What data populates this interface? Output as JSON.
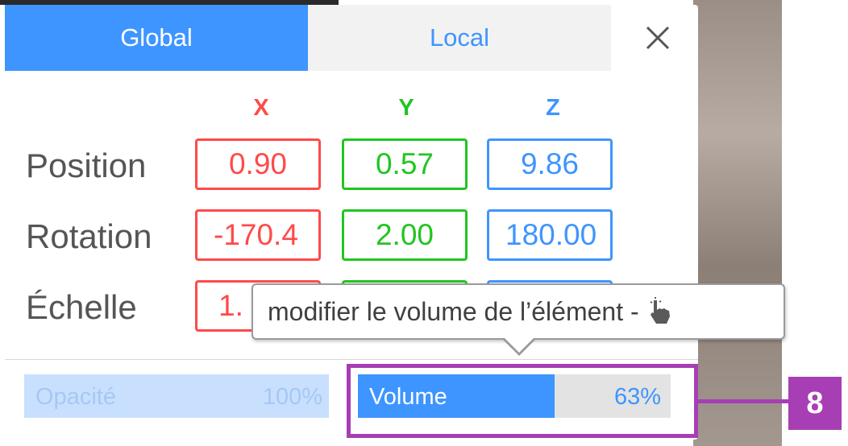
{
  "tabs": {
    "global": "Global",
    "local": "Local",
    "active": "global"
  },
  "axes": {
    "x": "X",
    "y": "Y",
    "z": "Z"
  },
  "rows": {
    "position": {
      "label": "Position",
      "x": "0.90",
      "y": "0.57",
      "z": "9.86"
    },
    "rotation": {
      "label": "Rotation",
      "x": "-170.4",
      "y": "2.00",
      "z": "180.00"
    },
    "scale": {
      "label": "Échelle",
      "x": "1.",
      "y": "",
      "z": ""
    }
  },
  "sliders": {
    "opacity": {
      "label": "Opacité",
      "value_text": "100%",
      "value": 1.0
    },
    "volume": {
      "label": "Volume",
      "value_text": "63%",
      "value": 0.63
    }
  },
  "tooltip": {
    "text": "modifier le volume de l’élément -",
    "icon": "pointing-hand-icon"
  },
  "step_badge": "8",
  "colors": {
    "accent": "#3e95ff",
    "x_axis": "#ff4a4a",
    "y_axis": "#21c521",
    "z_axis": "#3e95ff",
    "highlight": "#a73eb4"
  }
}
